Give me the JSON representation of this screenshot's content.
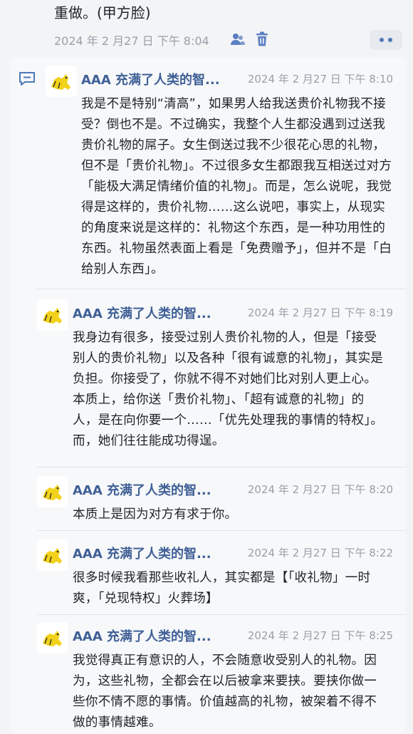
{
  "prev_post": {
    "text_tail": "重做。(甲方脸)",
    "timestamp": "2024 年 2 月27 日 下午 8:04",
    "icons": [
      "user-icon",
      "trash-icon"
    ],
    "more_label": "••"
  },
  "thread": {
    "icon": "comment-icon",
    "messages": [
      {
        "author": "AAA 充满了人类的智...",
        "time": "2024 年 2 月27 日 下午 8:10",
        "body": "我是不是特别“清高”，如果男人给我送贵价礼物我不接受？倒也不是。不过确实，我整个人生都没遇到过送我贵价礼物的屌子。女生倒送过我不少很花心思的礼物，但不是「贵价礼物」。不过很多女生都跟我互相送过对方「能极大满足情绪价值的礼物」。而是，怎么说呢，我觉得是这样的，贵价礼物……这么说吧，事实上，从现实的角度来说是这样的：礼物这个东西，是一种功用性的东西。礼物虽然表面上看是「免费赠予」，但并不是「白给别人东西」。"
      },
      {
        "author": "AAA 充满了人类的智...",
        "time": "2024 年 2 月27 日 下午 8:19",
        "body": "我身边有很多，接受过别人贵价礼物的人，但是「接受别人的贵价礼物」以及各种「很有诚意的礼物」，其实是负担。你接受了，你就不得不对她们比对别人更上心。本质上，给你送「贵价礼物」、「超有诚意的礼物」的人，是在向你要一个……「优先处理我的事情的特权」。而，她们往往能成功得逞。"
      },
      {
        "author": "AAA 充满了人类的智...",
        "time": "2024 年 2 月27 日 下午 8:20",
        "body": "本质上是因为对方有求于你。"
      },
      {
        "author": "AAA 充满了人类的智...",
        "time": "2024 年 2 月27 日 下午 8:22",
        "body": "很多时候我看那些收礼人，其实都是【「收礼物」一时爽，「兑现特权」火葬场】"
      },
      {
        "author": "AAA 充满了人类的智...",
        "time": "2024 年 2 月27 日 下午 8:25",
        "body": "我觉得真正有意识的人，不会随意收受别人的礼物。因为，这些礼物，全都会在以后被拿来要挟。要挟你做一些你不情不愿的事情。价值越高的礼物，被架着不得不做的事情越难。"
      }
    ]
  }
}
